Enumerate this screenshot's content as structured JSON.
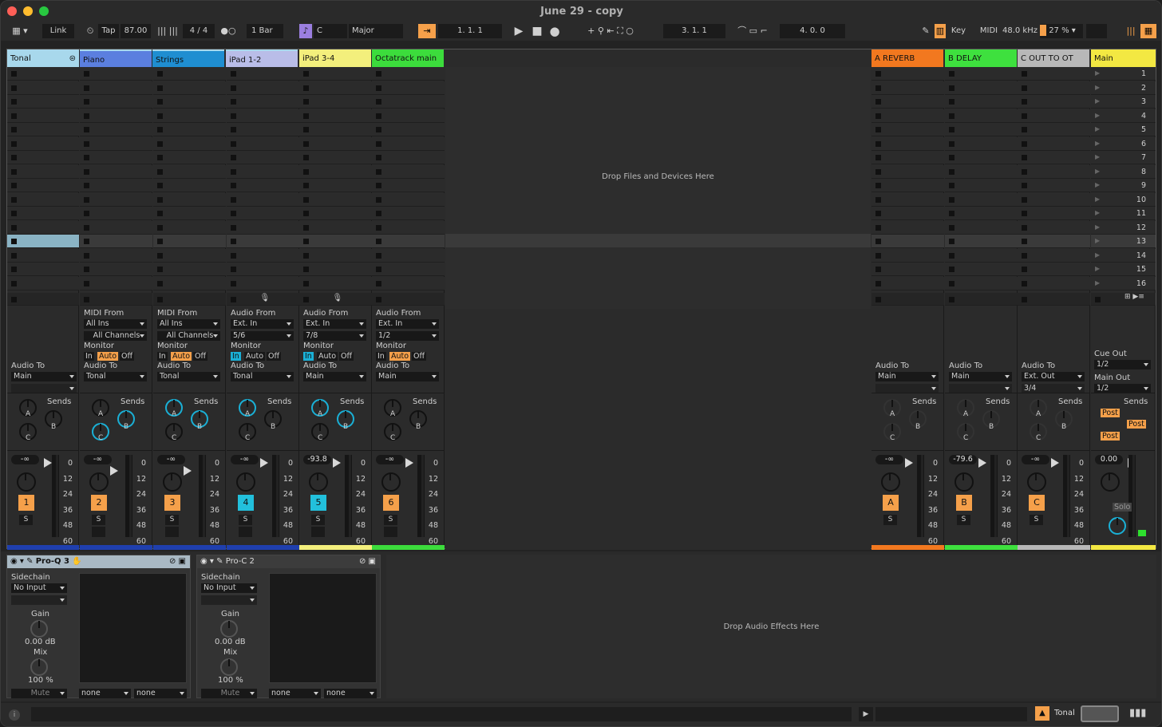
{
  "window": {
    "title": "June 29 - copy"
  },
  "control_bar": {
    "link": "Link",
    "tap": "Tap",
    "tempo": "87.00",
    "signature": "4 / 4",
    "quantize": "1 Bar",
    "key": "C",
    "scale": "Major",
    "arrangement_position": "1.   1.   1",
    "loop_start": "3.   1.   1",
    "loop_length": "4.   0.   0",
    "key_map": "Key",
    "midi_map": "MIDI",
    "sample_rate": "48.0 kHz",
    "cpu": "27 %"
  },
  "tracks": [
    {
      "name": "Tonal",
      "color": "#a8d8ec",
      "number": "",
      "volume": "",
      "type": "group"
    },
    {
      "name": "Piano",
      "color": "#5b7fdf",
      "number": "2",
      "volume": "-∞",
      "input_label": "MIDI From",
      "input": "All Ins",
      "channel": "All Channels",
      "monitor_active": "Auto",
      "output": "Tonal"
    },
    {
      "name": "Strings",
      "color": "#1f8ed1",
      "number": "3",
      "volume": "-∞",
      "input_label": "MIDI From",
      "input": "All Ins",
      "channel": "All Channels",
      "monitor_active": "Auto",
      "output": "Tonal"
    },
    {
      "name": "iPad 1-2",
      "color": "#b9bde8",
      "number": "4",
      "volume": "-∞",
      "input_label": "Audio From",
      "input": "Ext. In",
      "channel": "5/6",
      "monitor_active": "In",
      "output": "Tonal"
    },
    {
      "name": "iPad 3-4",
      "color": "#f3ef7c",
      "number": "5",
      "volume": "-93.8",
      "input_label": "Audio From",
      "input": "Ext. In",
      "channel": "7/8",
      "monitor_active": "In",
      "output": "Main"
    },
    {
      "name": "Octatrack main",
      "color": "#3cdc3c",
      "number": "6",
      "volume": "-∞",
      "input_label": "Audio From",
      "input": "Ext. In",
      "channel": "1/2",
      "monitor_active": "Auto",
      "output": "Main"
    }
  ],
  "group_track": {
    "number": "1",
    "volume": "-∞",
    "output_label": "Audio To",
    "output": "Main"
  },
  "returns": [
    {
      "name": "A REVERB",
      "color": "#f2781f",
      "letter": "A",
      "volume": "-∞",
      "output": "Main"
    },
    {
      "name": "B DELAY",
      "color": "#3ee03e",
      "letter": "B",
      "volume": "-79.6",
      "output": "Main"
    },
    {
      "name": "C OUT TO OT",
      "color": "#b8b8b8",
      "letter": "C",
      "volume": "-∞",
      "output": "Ext. Out",
      "channel": "3/4"
    }
  ],
  "main": {
    "name": "Main",
    "color": "#f3e842",
    "volume": "0.00",
    "cue_out_label": "Cue Out",
    "cue_out": "1/2",
    "main_out_label": "Main Out",
    "main_out": "1/2",
    "solo": "Solo",
    "post": "Post"
  },
  "scenes": [
    "1",
    "2",
    "3",
    "4",
    "5",
    "6",
    "7",
    "8",
    "9",
    "10",
    "11",
    "12",
    "13",
    "14",
    "15",
    "16"
  ],
  "labels": {
    "audio_to": "Audio To",
    "monitor": "Monitor",
    "sends": "Sends",
    "in": "In",
    "auto": "Auto",
    "off": "Off",
    "a": "A",
    "b": "B",
    "c": "C",
    "s": "S",
    "drop_files": "Drop Files and Devices Here",
    "drop_fx": "Drop Audio Effects Here",
    "scale": [
      "0",
      "12",
      "24",
      "36",
      "48",
      "60"
    ]
  },
  "devices": [
    {
      "name": "Pro-Q 3",
      "sidechain": "Sidechain",
      "input": "No Input",
      "gain_label": "Gain",
      "gain": "0.00 dB",
      "mix_label": "Mix",
      "mix": "100 %",
      "mute": "Mute",
      "route1": "none",
      "route2": "none"
    },
    {
      "name": "Pro-C 2",
      "sidechain": "Sidechain",
      "input": "No Input",
      "gain_label": "Gain",
      "gain": "0.00 dB",
      "mix_label": "Mix",
      "mix": "100 %",
      "mute": "Mute",
      "route1": "none",
      "route2": "none"
    }
  ],
  "status_bar": {
    "selected_track": "Tonal"
  }
}
